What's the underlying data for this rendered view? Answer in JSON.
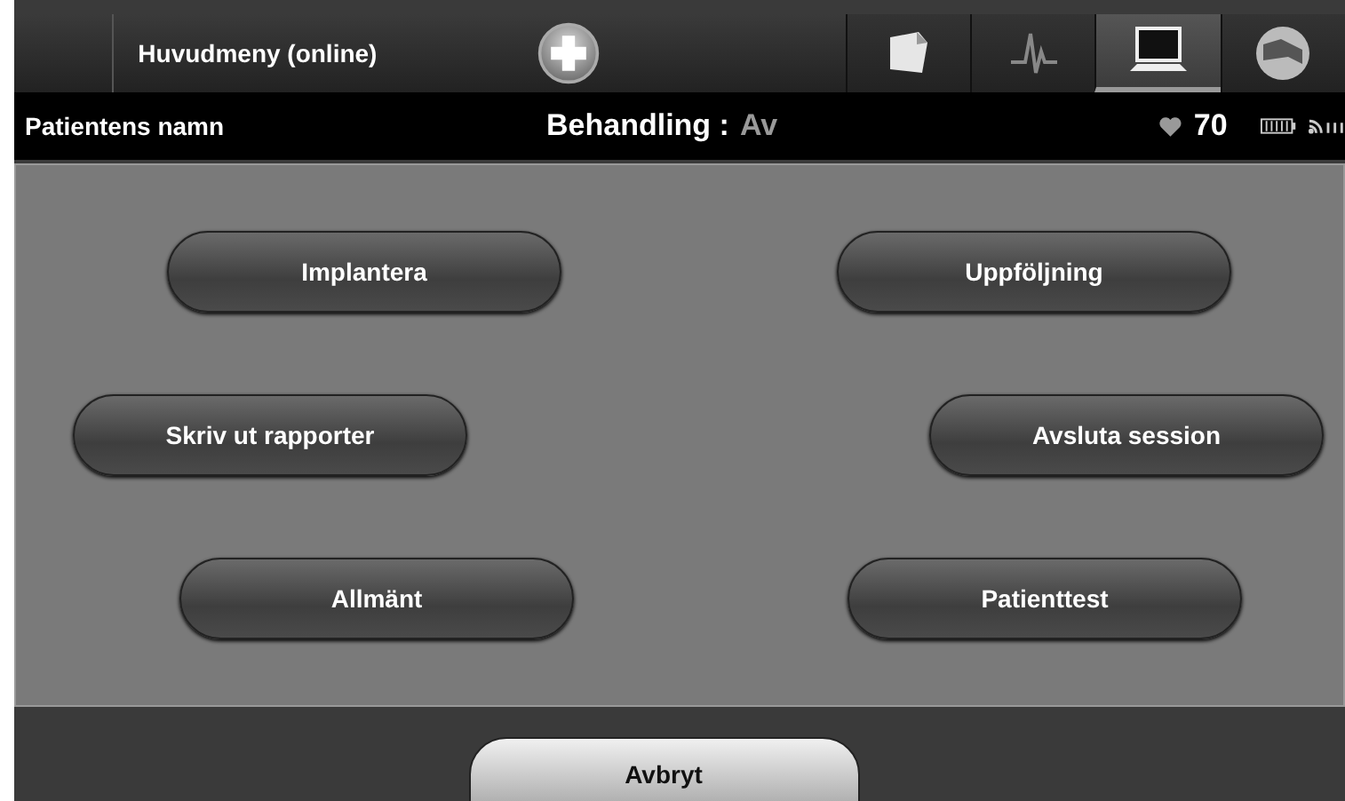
{
  "header": {
    "title": "Huvudmeny (online)"
  },
  "tabs": [
    {
      "kind": "notes",
      "selected": false
    },
    {
      "kind": "waveform",
      "selected": false
    },
    {
      "kind": "monitor",
      "selected": true
    },
    {
      "kind": "sphere",
      "selected": false
    }
  ],
  "status_bar": {
    "patient": "Patientens namn",
    "therapy_label": "Behandling :",
    "therapy_value": "Av",
    "heart_rate": "70"
  },
  "menu_buttons": [
    {
      "label": "Implantera"
    },
    {
      "label": "Uppföljning"
    },
    {
      "label": "Skriv ut rapporter"
    },
    {
      "label": "Avsluta session"
    },
    {
      "label": "Allmänt"
    },
    {
      "label": "Patienttest"
    }
  ],
  "cancel_button": "Avbryt"
}
